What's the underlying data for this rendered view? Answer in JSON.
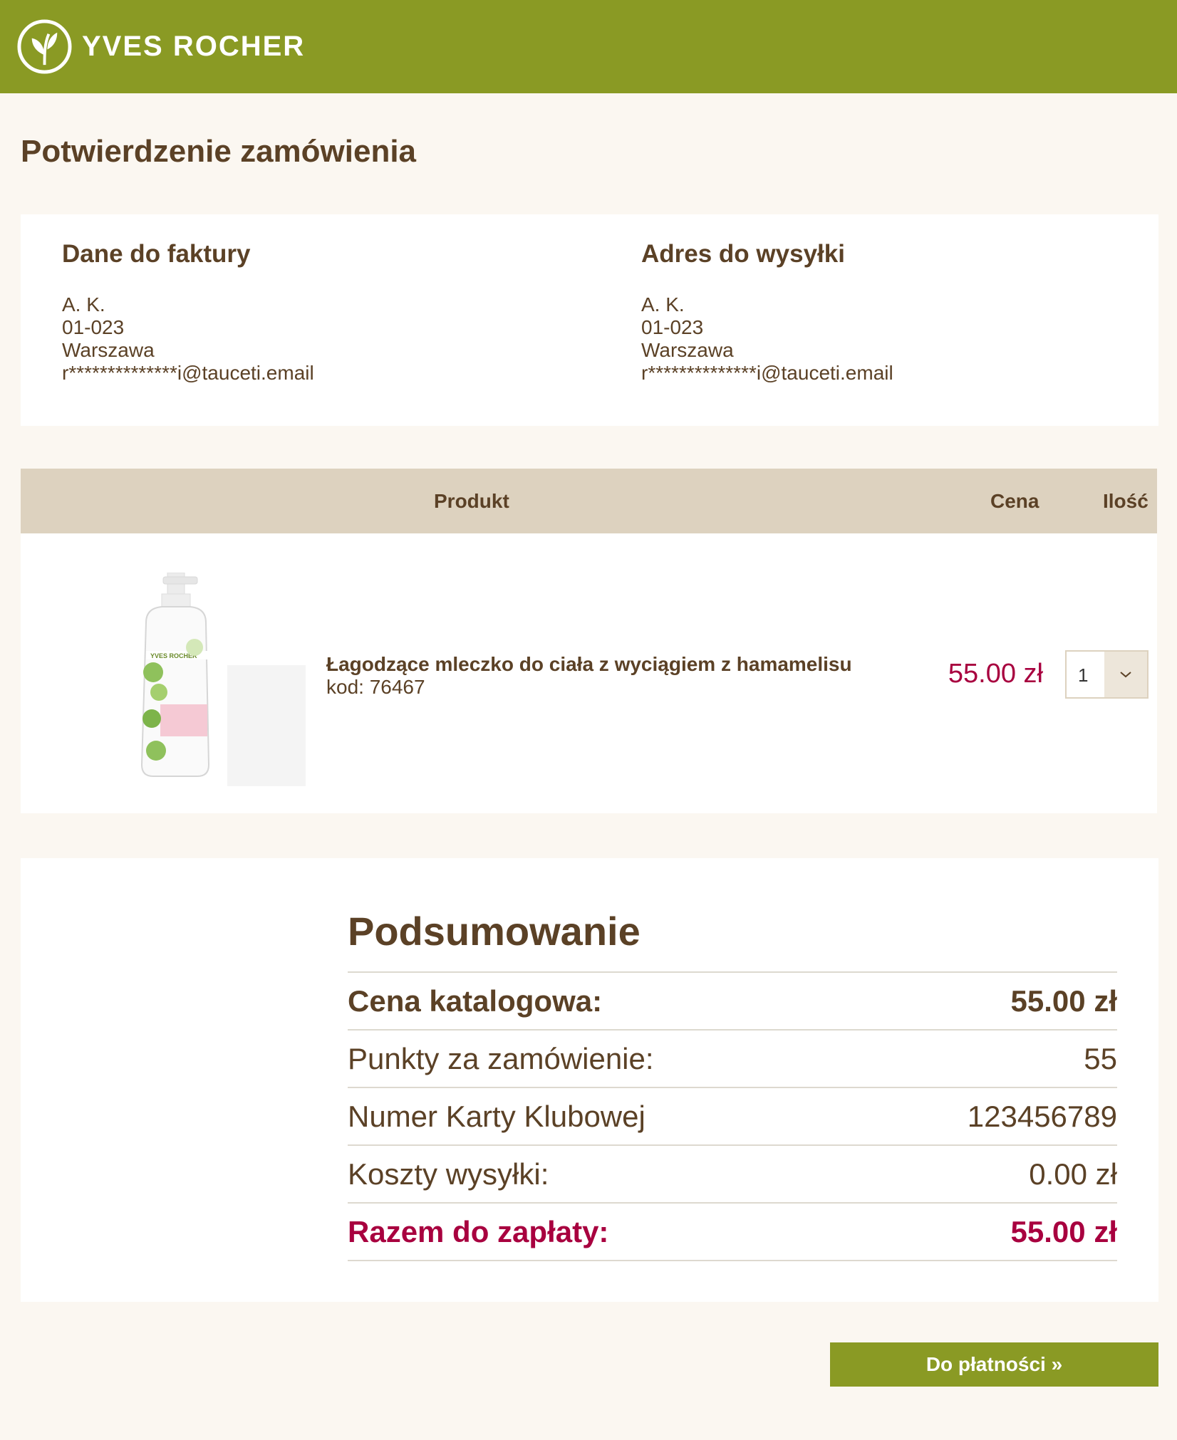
{
  "header": {
    "brand": "YVES ROCHER"
  },
  "page_title": "Potwierdzenie zamówienia",
  "billing": {
    "title": "Dane do faktury",
    "lines": [
      "A. K.",
      "01-023",
      "Warszawa",
      "r**************i@tauceti.email"
    ]
  },
  "shipping": {
    "title": "Adres do wysyłki",
    "lines": [
      "A. K.",
      "01-023",
      "Warszawa",
      "r**************i@tauceti.email"
    ]
  },
  "table": {
    "headers": {
      "product": "Produkt",
      "price": "Cena",
      "qty": "Ilość"
    },
    "items": [
      {
        "name": "Łagodzące mleczko do ciała z wyciągiem z hamamelisu",
        "code": "kod: 76467",
        "price": "55.00 zł",
        "qty": "1",
        "image_label": "YVES ROCHER"
      }
    ]
  },
  "summary": {
    "title": "Podsumowanie",
    "rows": [
      {
        "label": "Cena katalogowa:",
        "value": "55.00 zł"
      },
      {
        "label": "Punkty za zamówienie:",
        "value": "55"
      },
      {
        "label": "Numer Karty Klubowej",
        "value": "123456789"
      },
      {
        "label": "Koszty wysyłki:",
        "value": "0.00 zł"
      },
      {
        "label": "Razem do zapłaty:",
        "value": "55.00 zł"
      }
    ]
  },
  "pay_button": "Do płatności »",
  "colors": {
    "brand_green": "#8a9a24",
    "text_brown": "#5b4126",
    "accent_red": "#a8003f",
    "table_head": "#ddd2bf",
    "page_bg": "#fbf7f1"
  }
}
